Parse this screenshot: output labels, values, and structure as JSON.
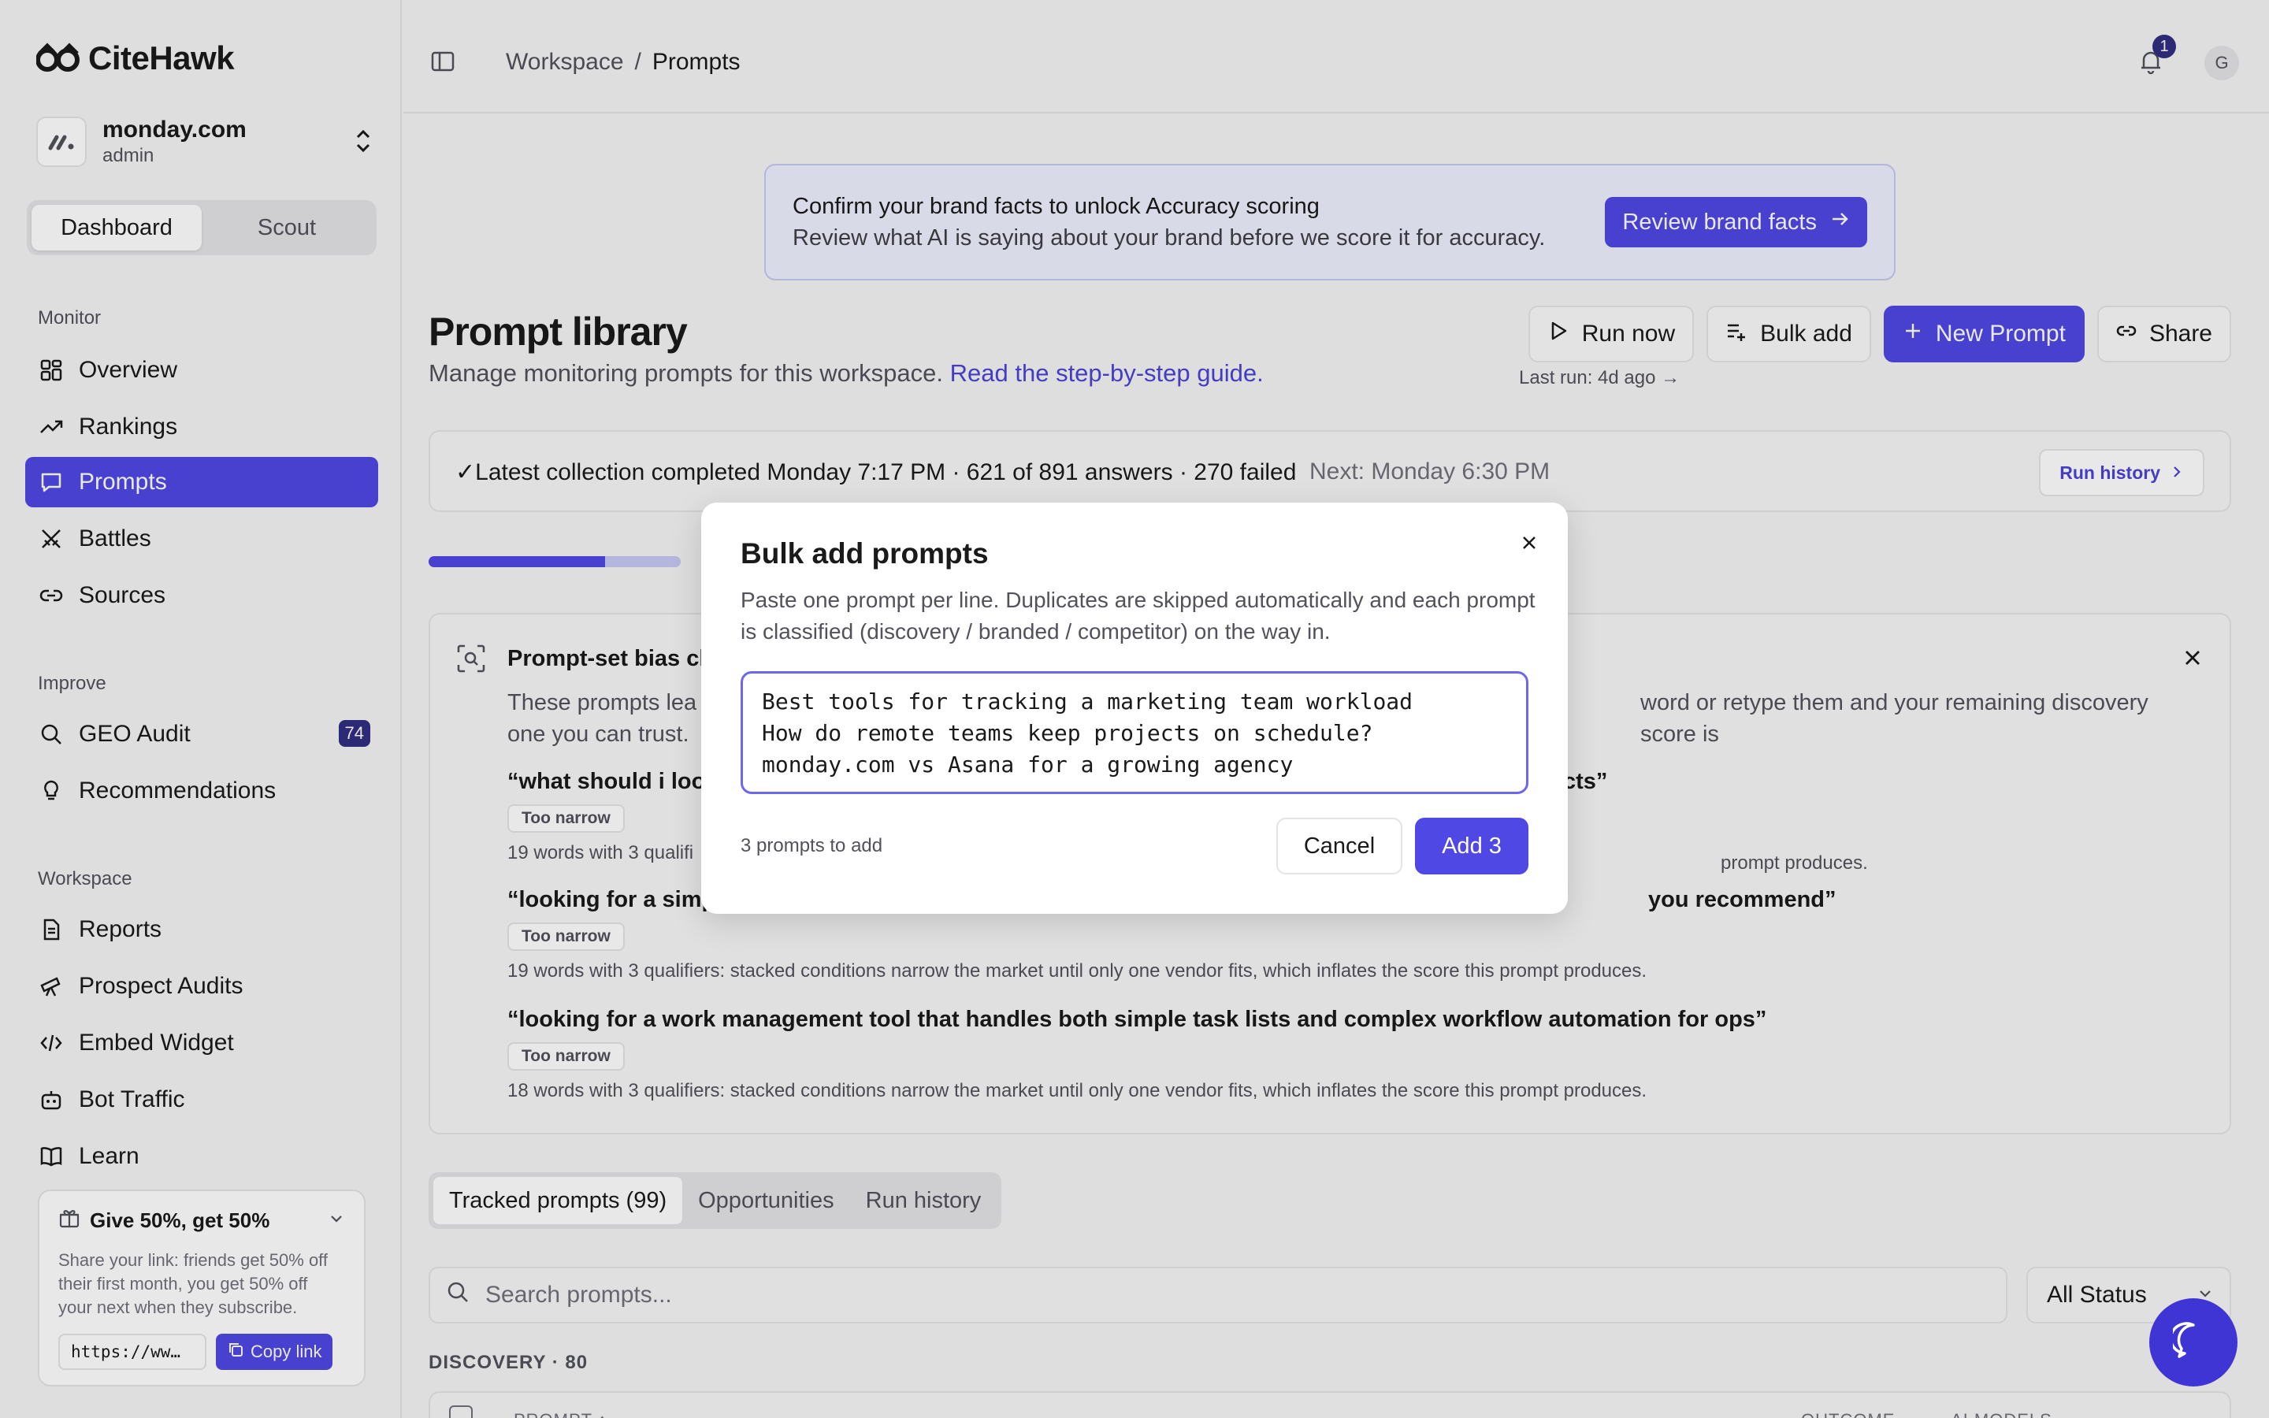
{
  "app": {
    "name": "CiteHawk"
  },
  "org": {
    "name": "monday.com",
    "role": "admin"
  },
  "mode_tabs": [
    "Dashboard",
    "Scout"
  ],
  "nav": {
    "monitor_label": "Monitor",
    "monitor": [
      "Overview",
      "Rankings",
      "Prompts",
      "Battles",
      "Sources"
    ],
    "improve_label": "Improve",
    "improve": [
      "GEO Audit",
      "Recommendations"
    ],
    "geo_audit_badge": "74",
    "workspace_label": "Workspace",
    "workspace": [
      "Reports",
      "Prospect Audits",
      "Embed Widget",
      "Bot Traffic",
      "Learn"
    ]
  },
  "referral": {
    "title": "Give 50%, get 50%",
    "text": "Share your link: friends get 50% off their first month, you get 50% off your next when they subscribe.",
    "link": "https://ww…",
    "copy_label": "Copy link"
  },
  "breadcrumb": {
    "root": "Workspace",
    "sep": "/",
    "current": "Prompts"
  },
  "notifications": {
    "count": "1"
  },
  "user_initial": "G",
  "banner": {
    "title": "Confirm your brand facts to unlock Accuracy scoring",
    "subtitle": "Review what AI is saying about your brand before we score it for accuracy.",
    "button": "Review brand facts"
  },
  "page": {
    "title": "Prompt library",
    "subtitle": "Manage monitoring prompts for this workspace.",
    "guide_link": "Read the step-by-step guide."
  },
  "actions": {
    "run_now": "Run now",
    "bulk_add": "Bulk add",
    "new_prompt": "New Prompt",
    "share": "Share",
    "last_run": "Last run: 4d ago →"
  },
  "collection": {
    "status": "✓Latest collection completed Monday 7:17 PM · 621 of 891 answers · 270 failed",
    "next": "Next: Monday 6:30 PM",
    "run_history": "Run history",
    "progress": 0.7
  },
  "bias": {
    "title": "Prompt-set bias ch",
    "desc_left": "These prompts lea",
    "desc_right": "word or retype them and your remaining discovery score is",
    "desc_line2": "one you can trust.",
    "items": [
      {
        "q_left": "“what should i look",
        "q_right": "cts”",
        "tag": "Too narrow",
        "why": "19 words with 3 qualifi",
        "why_right": "prompt produces."
      },
      {
        "q_left": "“looking for a simp",
        "q_right": "you recommend”",
        "tag": "Too narrow",
        "why": "19 words with 3 qualifiers: stacked conditions narrow the market until only one vendor fits, which inflates the score this prompt produces."
      },
      {
        "q_left": "“looking for a work management tool that handles both simple task lists and complex workflow automation for ops”",
        "q_right": "",
        "tag": "Too narrow",
        "why": "18 words with 3 qualifiers: stacked conditions narrow the market until only one vendor fits, which inflates the score this prompt produces."
      }
    ]
  },
  "tabs": [
    "Tracked prompts (99)",
    "Opportunities",
    "Run history"
  ],
  "search": {
    "placeholder": "Search prompts..."
  },
  "status_filter": "All Status",
  "discovery_label": "DISCOVERY · 80",
  "table_headers": {
    "prompt": "PROMPT ↕",
    "outcome": "OUTCOME",
    "models": "AI MODELS"
  },
  "modal": {
    "title": "Bulk add prompts",
    "description": "Paste one prompt per line. Duplicates are skipped automatically and each prompt is classified (discovery / branded / competitor) on the way in.",
    "textarea": "Best tools for tracking a marketing team workload\nHow do remote teams keep projects on schedule?\nmonday.com vs Asana for a growing agency",
    "count": "3 prompts to add",
    "cancel": "Cancel",
    "add": "Add 3"
  },
  "colors": {
    "accent": "#5048e5",
    "badge": "#312e81",
    "banner_bg": "#eef0ff"
  }
}
